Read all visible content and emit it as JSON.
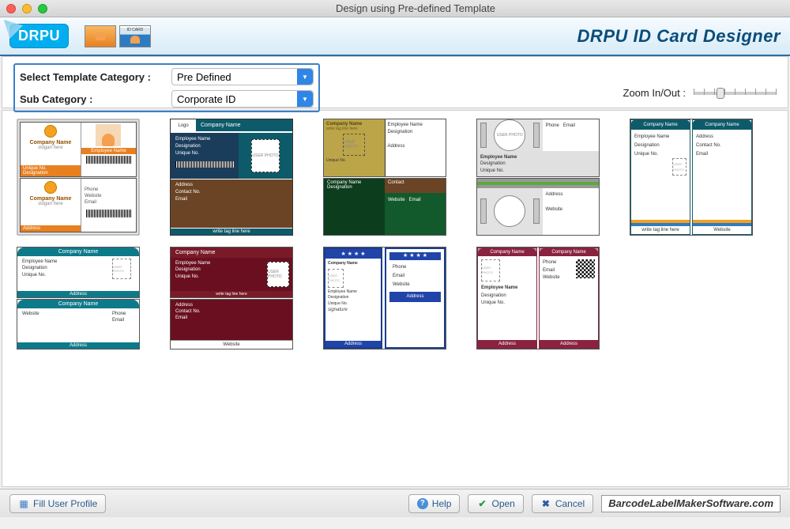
{
  "window": {
    "title": "Design using Pre-defined Template"
  },
  "header": {
    "app_name": "DRPU ID Card Designer",
    "logo_text": "DRPU",
    "sample_card_label": "ID CARD"
  },
  "controls": {
    "category_label": "Select Template Category :",
    "category_value": "Pre Defined",
    "subcategory_label": "Sub Category :",
    "subcategory_value": "Corporate ID",
    "zoom_label": "Zoom In/Out :"
  },
  "placeholders": {
    "company_name": "Company Name",
    "slogan": "slogan here",
    "employee_name": "Employee Name",
    "designation": "Designation",
    "unique_no": "Unique No.",
    "address": "Address",
    "phone": "Phone",
    "website": "Website",
    "email": "Email",
    "contact_no": "Contact No.",
    "contact": "Contact",
    "logo": "Logo",
    "user_photo": "USER\nPHOTO",
    "tag_line": "write tag line here"
  },
  "bottom": {
    "fill_profile": "Fill User Profile",
    "help": "Help",
    "open": "Open",
    "cancel": "Cancel",
    "url": "BarcodeLabelMakerSoftware.com"
  }
}
